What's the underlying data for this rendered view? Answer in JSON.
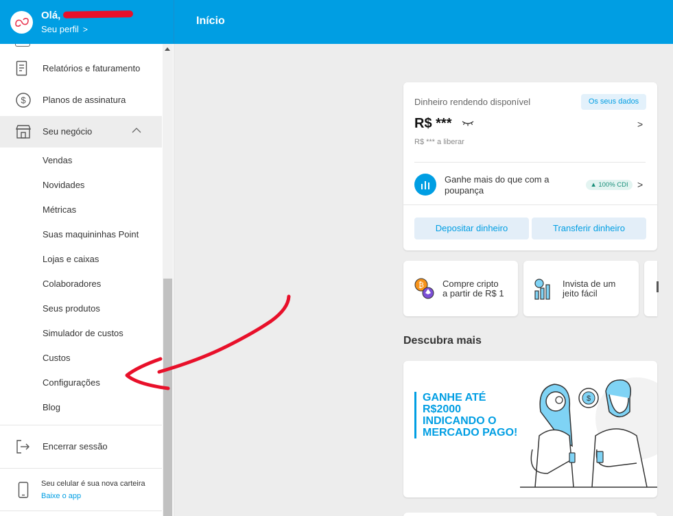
{
  "header": {
    "greeting": "Olá,",
    "profile_link": "Seu perfil",
    "page_title": "Início"
  },
  "sidebar": {
    "items": [
      {
        "label": "Relatórios e faturamento",
        "icon": "receipt-icon"
      },
      {
        "label": "Planos de assinatura",
        "icon": "dollar-cycle-icon"
      },
      {
        "label": "Seu negócio",
        "icon": "store-icon"
      }
    ],
    "sub_items": [
      "Vendas",
      "Novidades",
      "Métricas",
      "Suas maquininhas Point",
      "Lojas e caixas",
      "Colaboradores",
      "Seus produtos",
      "Simulador de custos",
      "Custos",
      "Configurações",
      "Blog"
    ],
    "logout_label": "Encerrar sessão",
    "app_text": "Seu celular é sua nova carteira",
    "app_link": "Baixe o app"
  },
  "balance": {
    "label": "Dinheiro rendendo disponível",
    "badge": "Os seus dados",
    "amount": "R$ ***",
    "sub": "R$ *** a liberar",
    "promo_text": "Ganhe mais do que com a poupança",
    "promo_badge": "▲ 100% CDI",
    "deposit_label": "Depositar dinheiro",
    "transfer_label": "Transferir dinheiro"
  },
  "shortcuts": [
    {
      "label_line1": "Compre cripto",
      "label_line2": "a partir de R$ 1"
    },
    {
      "label_line1": "Invista de um",
      "label_line2": "jeito fácil"
    }
  ],
  "discover": {
    "title": "Descubra mais",
    "banner_lines": [
      "GANHE ATÉ",
      "R$2000",
      "INDICANDO O",
      "MERCADO PAGO!"
    ]
  },
  "colors": {
    "brand_blue": "#009ee3",
    "annotation_red": "#e8102a"
  }
}
